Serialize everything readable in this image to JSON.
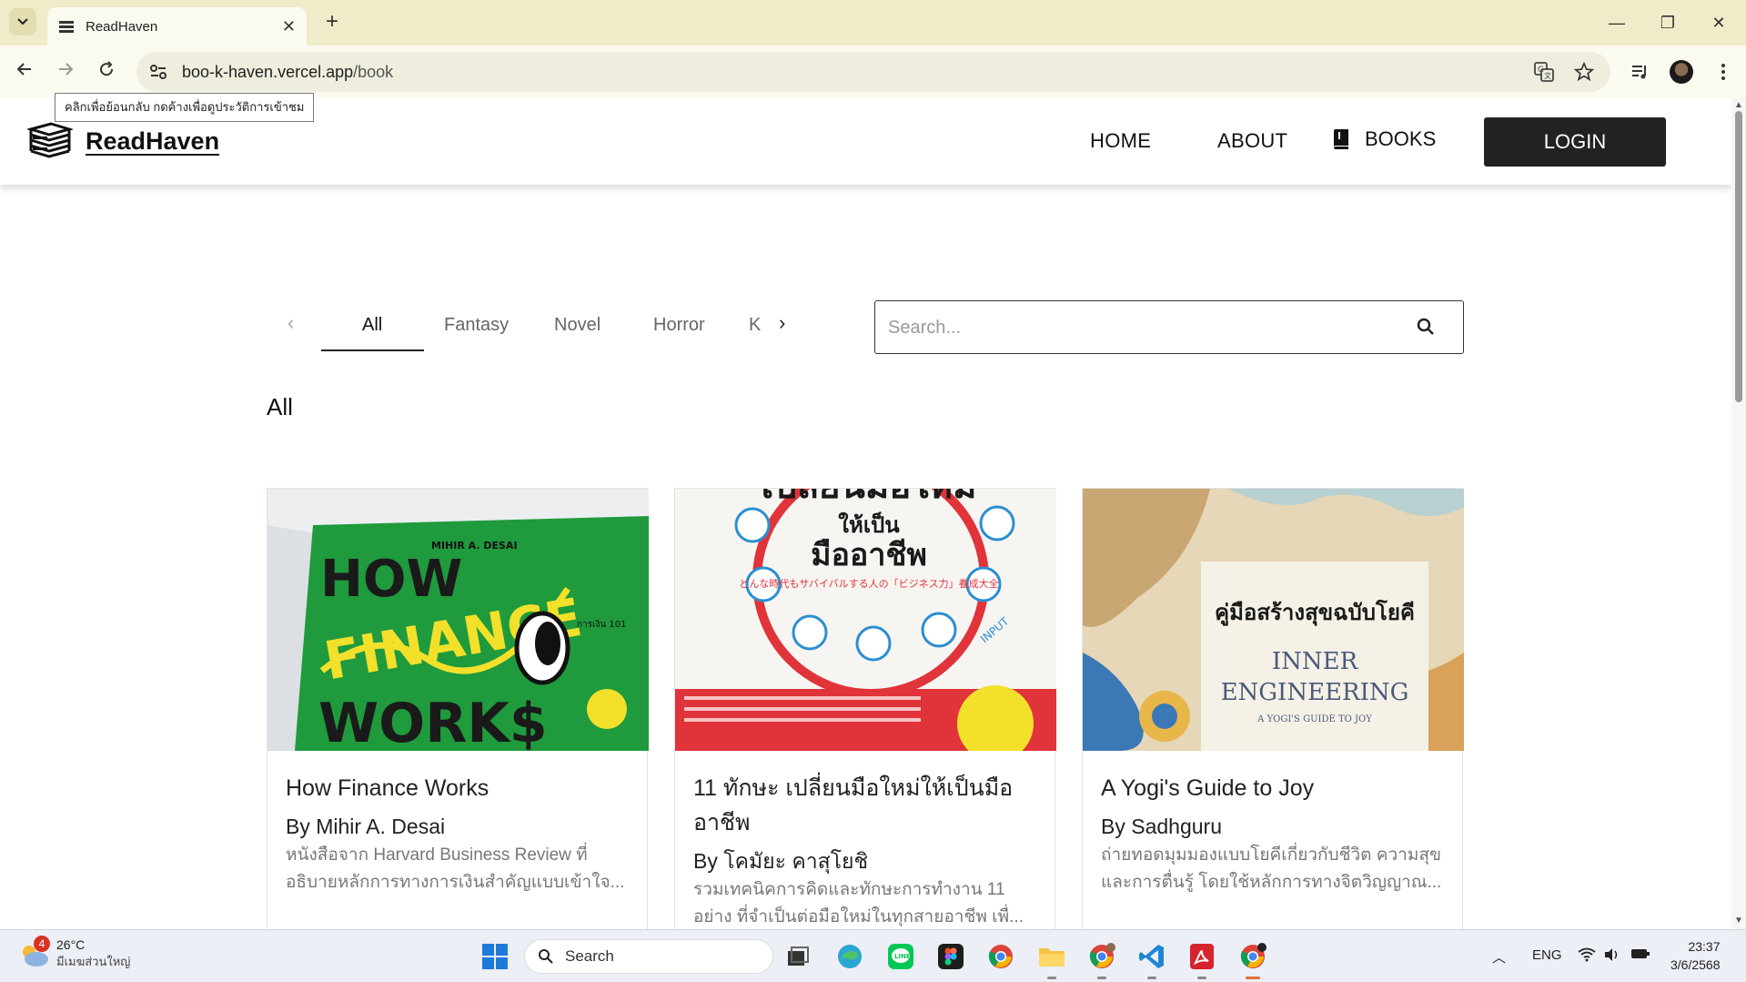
{
  "browser": {
    "tab_title": "ReadHaven",
    "url_domain": "boo-k-haven.vercel.app",
    "url_path": "/book",
    "tooltip": "คลิกเพื่อย้อนกลับ กดค้างเพื่อดูประวัติการเข้าชม"
  },
  "header": {
    "logo_text": "ReadHaven",
    "nav": {
      "home": "HOME",
      "about": "ABOUT",
      "books": "BOOKS"
    },
    "login": "LOGIN"
  },
  "categories": {
    "tabs": [
      "All",
      "Fantasy",
      "Novel",
      "Horror",
      "K"
    ],
    "active": "All"
  },
  "search": {
    "placeholder": "Search..."
  },
  "section_title": "All",
  "books": [
    {
      "title": "How Finance Works",
      "author": "By Mihir A. Desai",
      "description": "หนังสือจาก Harvard Business Review ที่อธิบายหลักการทางการเงินสำคัญแบบเข้าใจ...",
      "cover": {
        "publisher_line": "MIHIR A. DESAI",
        "words": [
          "HOW",
          "FINANCE",
          "WORK$"
        ],
        "side_text": "การเงิน 101",
        "colors": {
          "bg": "#1f9a3d",
          "text": "#1a1a1a",
          "accent": "#f2e02a"
        }
      }
    },
    {
      "title": "11 ทักษะ เปลี่ยนมือใหม่ให้เป็นมืออาชีพ",
      "author": "By โคมัยะ คาสุโยชิ",
      "description": "รวมเทคนิคการคิดและทักษะการทำงาน 11 อย่าง ที่จำเป็นต่อมือใหม่ในทุกสายอาชีพ เพื่...",
      "cover": {
        "lines": [
          "เปลี่ยนมือใหม่",
          "ให้เป็น",
          "มืออาชีพ"
        ],
        "japanese": "どんな時代もサバイバルする人の「ビジネス力」養成大全",
        "badge": "INPUT",
        "colors": {
          "bg": "#f7f5f2",
          "ring": "#e0333a",
          "accent": "#2a8fd1",
          "band": "#e0333a"
        }
      }
    },
    {
      "title": "A Yogi's Guide to Joy",
      "author": "By Sadhguru",
      "description": "ถ่ายทอดมุมมองแบบโยคีเกี่ยวกับชีวิต ความสุข และการตื่นรู้ โดยใช้หลักการทางจิตวิญญาณ...",
      "cover": {
        "thai_title": "คู่มือสร้างสุขฉบับโยคี",
        "english_lines": [
          "INNER",
          "ENGINEERING"
        ],
        "subtitle": "A YOGI'S GUIDE TO JOY",
        "colors": {
          "bg": "#e6d7b8",
          "label": "#f5f1e6",
          "text": "#4a5a7a"
        }
      }
    }
  ],
  "taskbar": {
    "weather_temp": "26°C",
    "weather_location": "มีเมฆส่วนใหญ่",
    "weather_badge": "4",
    "search_label": "Search",
    "language": "ENG",
    "time": "23:37",
    "date": "3/6/2568"
  }
}
